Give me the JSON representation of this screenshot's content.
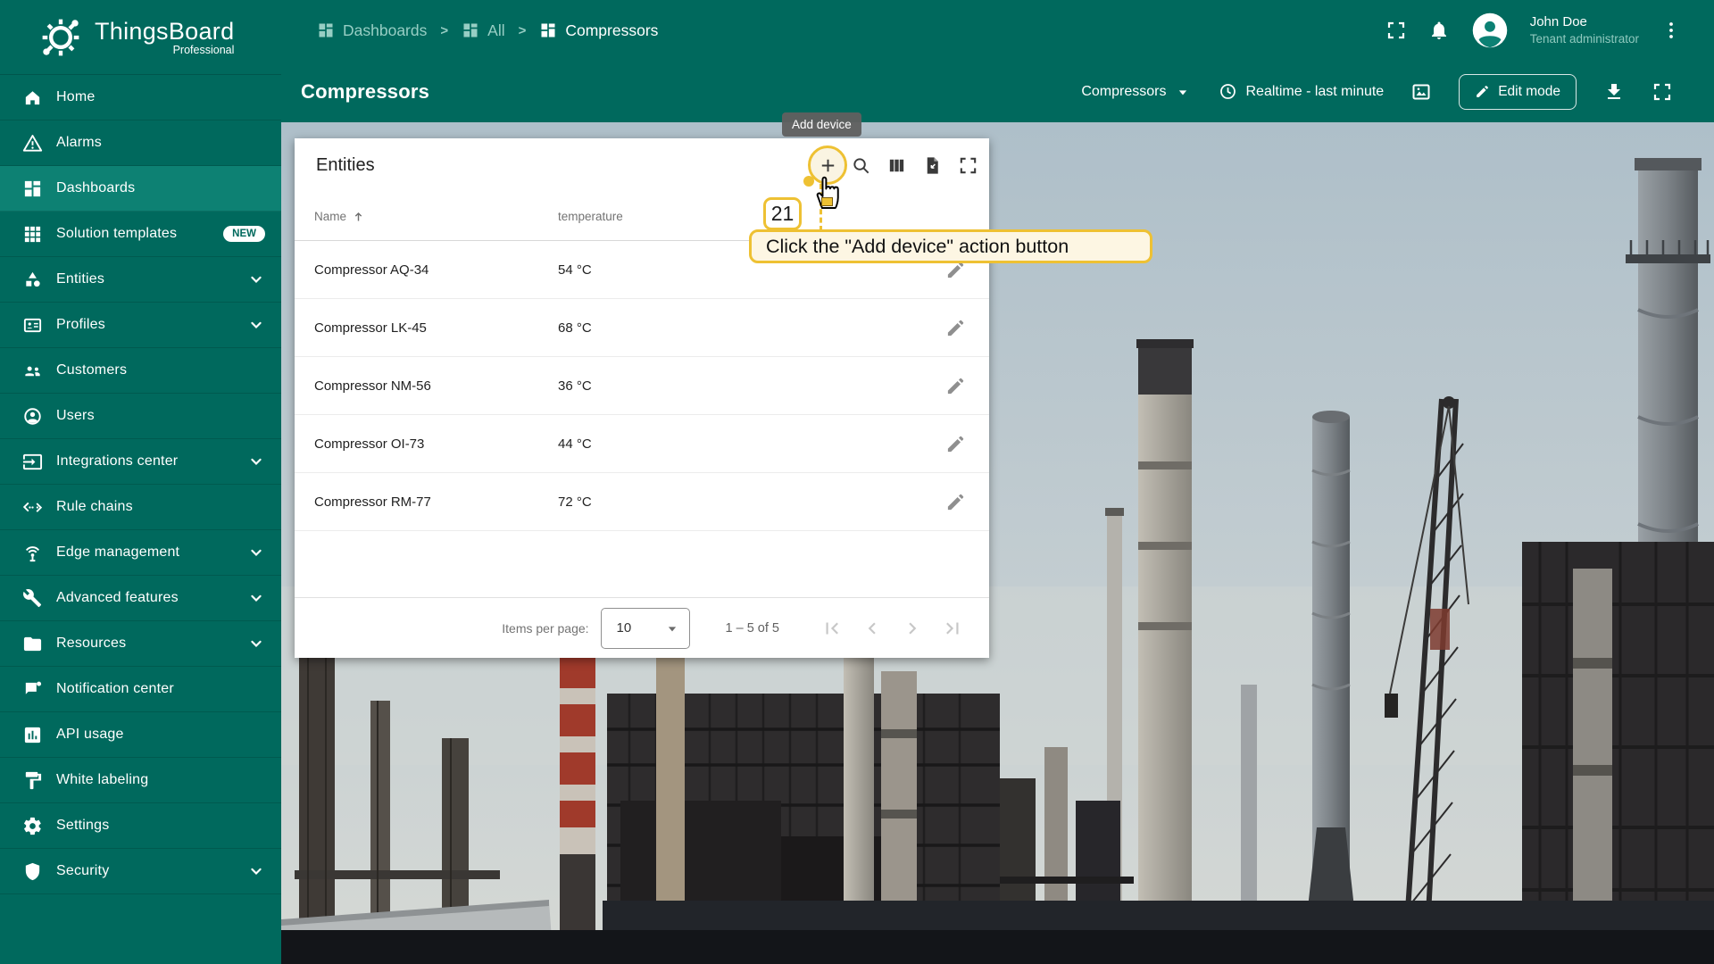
{
  "colors": {
    "teal": "#00695d",
    "teal_active": "#0d8173",
    "accent_yellow": "#eec133",
    "callout_bg": "#fdf6e3",
    "tooltip_bg": "#616161"
  },
  "brand": {
    "title": "ThingsBoard",
    "subtitle": "Professional",
    "logo_icon": "thingsboard-gear-icon"
  },
  "sidebar": {
    "items": [
      {
        "label": "Home",
        "icon": "home-icon"
      },
      {
        "label": "Alarms",
        "icon": "warning-icon"
      },
      {
        "label": "Dashboards",
        "icon": "dashboards-icon",
        "active": true
      },
      {
        "label": "Solution templates",
        "icon": "grid-icon",
        "badge": "NEW"
      },
      {
        "label": "Entities",
        "icon": "entities-icon",
        "chevron": true
      },
      {
        "label": "Profiles",
        "icon": "profiles-icon",
        "chevron": true
      },
      {
        "label": "Customers",
        "icon": "customers-icon"
      },
      {
        "label": "Users",
        "icon": "user-icon"
      },
      {
        "label": "Integrations center",
        "icon": "integrations-icon",
        "chevron": true
      },
      {
        "label": "Rule chains",
        "icon": "rule-chains-icon"
      },
      {
        "label": "Edge management",
        "icon": "edge-icon",
        "chevron": true
      },
      {
        "label": "Advanced features",
        "icon": "tools-icon",
        "chevron": true
      },
      {
        "label": "Resources",
        "icon": "folder-icon",
        "chevron": true
      },
      {
        "label": "Notification center",
        "icon": "notification-icon"
      },
      {
        "label": "API usage",
        "icon": "api-usage-icon"
      },
      {
        "label": "White labeling",
        "icon": "white-label-icon"
      },
      {
        "label": "Settings",
        "icon": "gear-icon"
      },
      {
        "label": "Security",
        "icon": "shield-icon",
        "chevron": true
      }
    ]
  },
  "topbar": {
    "breadcrumbs": [
      {
        "label": "Dashboards",
        "icon": "dashboards-icon"
      },
      {
        "label": "All",
        "icon": "dashboards-icon"
      },
      {
        "label": "Compressors",
        "icon": "dashboards-icon",
        "current": true
      }
    ],
    "separator": ">",
    "user": {
      "name": "John Doe",
      "role": "Tenant administrator"
    }
  },
  "toolbar": {
    "title": "Compressors",
    "dashboard_select": "Compressors",
    "timewindow": "Realtime - last minute",
    "edit_button": "Edit mode"
  },
  "entities_card": {
    "title": "Entities",
    "actions": [
      {
        "name": "add-entity-button",
        "icon": "plus-icon",
        "highlight": true
      },
      {
        "name": "search-button",
        "icon": "search-icon"
      },
      {
        "name": "columns-button",
        "icon": "columns-icon"
      },
      {
        "name": "export-button",
        "icon": "export-file-icon"
      },
      {
        "name": "fullscreen-widget-button",
        "icon": "fullscreen-icon"
      }
    ],
    "columns": [
      {
        "label": "Name",
        "sort": "asc"
      },
      {
        "label": "temperature"
      }
    ],
    "rows": [
      {
        "name": "Compressor AQ-34",
        "temperature": "54 °C"
      },
      {
        "name": "Compressor LK-45",
        "temperature": "68 °C"
      },
      {
        "name": "Compressor NM-56",
        "temperature": "36 °C"
      },
      {
        "name": "Compressor OI-73",
        "temperature": "44 °C"
      },
      {
        "name": "Compressor RM-77",
        "temperature": "72 °C"
      }
    ],
    "row_action_icon": "pencil-icon",
    "footer": {
      "items_per_page_label": "Items per page:",
      "items_per_page_value": "10",
      "range_label": "1 – 5 of 5",
      "pager": [
        "first-page-icon",
        "previous-page-icon",
        "next-page-icon",
        "last-page-icon"
      ]
    }
  },
  "annotation": {
    "tooltip": "Add device",
    "step_number": "21",
    "instruction": "Click the \"Add device\" action button"
  }
}
